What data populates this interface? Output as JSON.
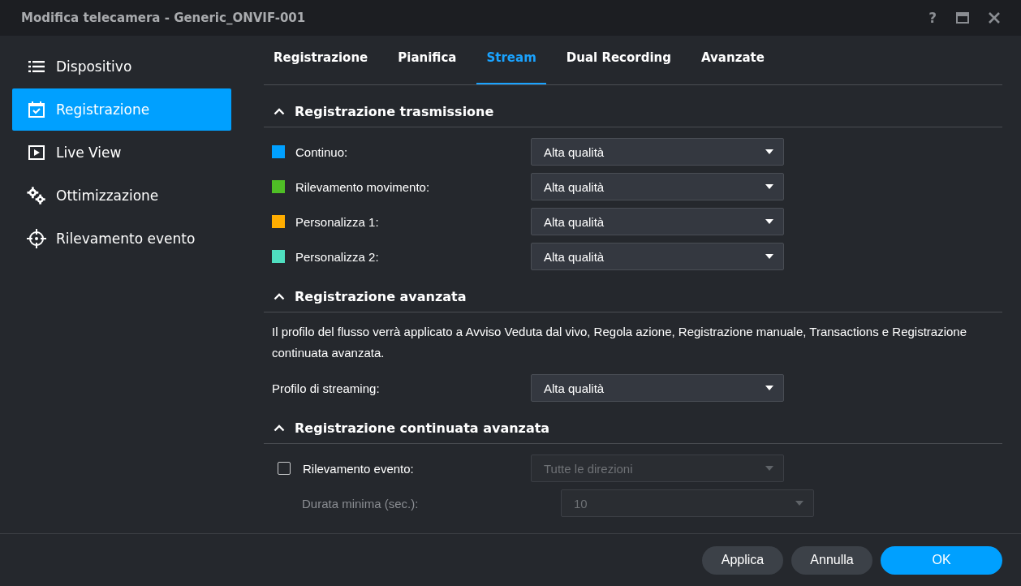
{
  "window": {
    "title": "Modifica telecamera - Generic_ONVIF-001",
    "help": "?"
  },
  "sidebar": {
    "items": [
      {
        "label": "Dispositivo",
        "kind": "list",
        "selected": false
      },
      {
        "label": "Registrazione",
        "kind": "calendar",
        "selected": true
      },
      {
        "label": "Live View",
        "kind": "play",
        "selected": false
      },
      {
        "label": "Ottimizzazione",
        "kind": "gears",
        "selected": false
      },
      {
        "label": "Rilevamento evento",
        "kind": "target",
        "selected": false
      }
    ]
  },
  "tabs": [
    {
      "label": "Registrazione",
      "selected": false
    },
    {
      "label": "Pianifica",
      "selected": false
    },
    {
      "label": "Stream",
      "selected": true
    },
    {
      "label": "Dual Recording",
      "selected": false
    },
    {
      "label": "Avanzate",
      "selected": false
    }
  ],
  "sections": [
    {
      "title": "Registrazione trasmissione",
      "expanded": true,
      "rows": [
        {
          "kind": "colored",
          "label": "Continuo:",
          "color": "#00a0ff",
          "value": "Alta qualità",
          "disabled": false
        },
        {
          "kind": "colored",
          "label": "Rilevamento movimento:",
          "color": "#4fbf26",
          "value": "Alta qualità",
          "disabled": false
        },
        {
          "kind": "colored",
          "label": "Personalizza 1:",
          "color": "#ffad00",
          "value": "Alta qualità",
          "disabled": false
        },
        {
          "kind": "colored",
          "label": "Personalizza 2:",
          "color": "#4fdfc0",
          "value": "Alta qualità",
          "disabled": false
        }
      ]
    },
    {
      "title": "Registrazione avanzata",
      "expanded": true,
      "rows": [
        {
          "kind": "text",
          "text": "Il profilo del flusso verrà applicato a Avviso Veduta dal vivo, Regola azione, Registrazione manuale, Transactions e Registrazione continuata avanzata."
        },
        {
          "kind": "plain",
          "label": "Profilo di streaming:",
          "value": "Alta qualità",
          "disabled": false
        }
      ]
    },
    {
      "title": "Registrazione continuata avanzata",
      "expanded": true,
      "rows": [
        {
          "kind": "checkbox",
          "label": "Rilevamento evento:",
          "checked": false,
          "value": "Tutte le direzioni",
          "disabled": true
        },
        {
          "kind": "indented",
          "label": "Durata minima (sec.):",
          "value": "10",
          "disabled": true
        }
      ]
    }
  ],
  "buttons": [
    {
      "label": "Applica",
      "kind": "secondary"
    },
    {
      "label": "Annulla",
      "kind": "secondary"
    },
    {
      "label": "OK",
      "kind": "primary"
    }
  ]
}
